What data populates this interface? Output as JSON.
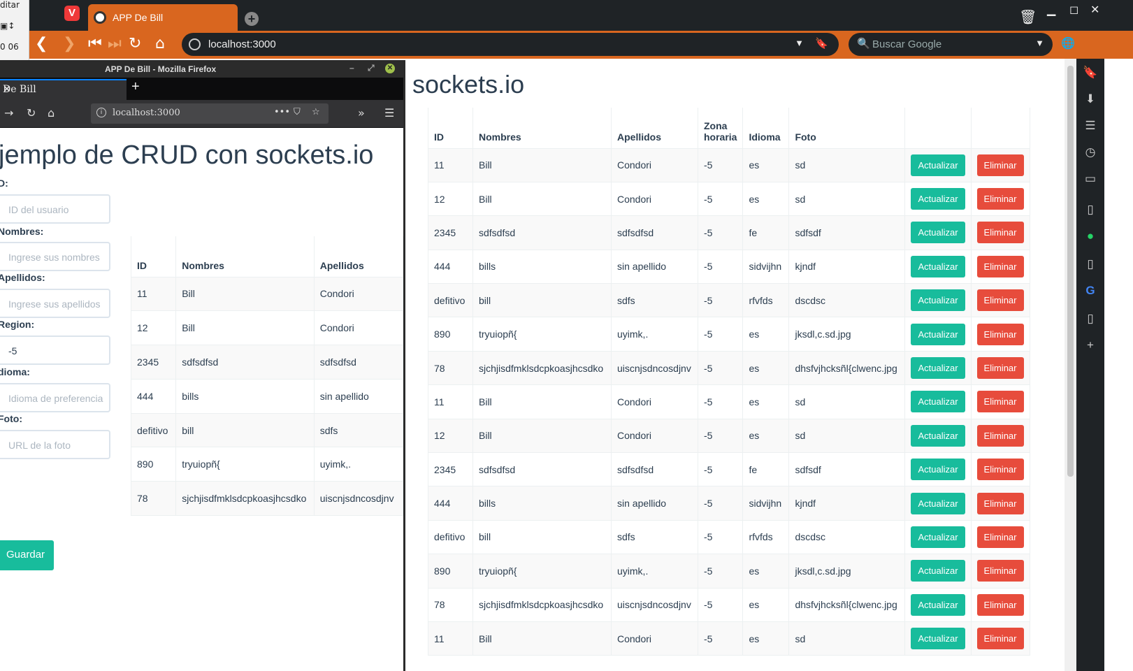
{
  "desktop": {
    "label_top": "ditar",
    "clock": "0 06"
  },
  "vivaldi": {
    "tab_title": "APP De Bill",
    "url": "localhost:3000",
    "search_placeholder": "Buscar Google"
  },
  "main_page": {
    "title_fragment": "n sockets.io",
    "columns": [
      "ID",
      "Nombres",
      "Apellidos",
      "Zona horaria",
      "Idioma",
      "Foto"
    ],
    "update_label": "Actualizar",
    "delete_label": "Eliminar",
    "rows": [
      [
        "11",
        "Bill",
        "Condori",
        "-5",
        "es",
        "sd"
      ],
      [
        "12",
        "Bill",
        "Condori",
        "-5",
        "es",
        "sd"
      ],
      [
        "2345",
        "sdfsdfsd",
        "sdfsdfsd",
        "-5",
        "fe",
        "sdfsdf"
      ],
      [
        "444",
        "bills",
        "sin apellido",
        "-5",
        "sidvijhn",
        "kjndf"
      ],
      [
        "defitivo",
        "bill",
        "sdfs",
        "-5",
        "rfvfds",
        "dscdsc"
      ],
      [
        "890",
        "tryuiopñ{",
        "uyimk,.",
        "-5",
        "es",
        "jksdl,c.sd.jpg"
      ],
      [
        "78",
        "sjchjisdfmklsdcpkoasjhcsdko",
        "uiscnjsdncosdjnv",
        "-5",
        "es",
        "dhsfvjhcksñl{clwenc.jpg"
      ],
      [
        "11",
        "Bill",
        "Condori",
        "-5",
        "es",
        "sd"
      ],
      [
        "12",
        "Bill",
        "Condori",
        "-5",
        "es",
        "sd"
      ],
      [
        "2345",
        "sdfsdfsd",
        "sdfsdfsd",
        "-5",
        "fe",
        "sdfsdf"
      ],
      [
        "444",
        "bills",
        "sin apellido",
        "-5",
        "sidvijhn",
        "kjndf"
      ],
      [
        "defitivo",
        "bill",
        "sdfs",
        "-5",
        "rfvfds",
        "dscdsc"
      ],
      [
        "890",
        "tryuiopñ{",
        "uyimk,.",
        "-5",
        "es",
        "jksdl,c.sd.jpg"
      ],
      [
        "78",
        "sjchjisdfmklsdcpkoasjhcsdko",
        "uiscnjsdncosdjnv",
        "-5",
        "es",
        "dhsfvjhcksñl{clwenc.jpg"
      ],
      [
        "11",
        "Bill",
        "Condori",
        "-5",
        "es",
        "sd"
      ]
    ]
  },
  "firefox": {
    "window_title": "APP De Bill - Mozilla Firefox",
    "tab_title": "De Bill",
    "url": "localhost:3000",
    "heading": "jemplo de CRUD con sockets.io",
    "form": {
      "id_label": "D:",
      "id_placeholder": "ID del usuario",
      "nombres_label": "Nombres:",
      "nombres_placeholder": "Ingrese sus nombres",
      "apellidos_label": "Apellidos:",
      "apellidos_placeholder": "Ingrese sus apellidos",
      "region_label": "Region:",
      "region_value": "-5",
      "idioma_label": "dioma:",
      "idioma_placeholder": "Idioma de preferencia",
      "foto_label": "Foto:",
      "foto_placeholder": "URL de la foto",
      "save_label": "Guardar"
    },
    "columns": [
      "ID",
      "Nombres",
      "Apellidos"
    ],
    "rows": [
      [
        "11",
        "Bill",
        "Condori"
      ],
      [
        "12",
        "Bill",
        "Condori"
      ],
      [
        "2345",
        "sdfsdfsd",
        "sdfsdfsd"
      ],
      [
        "444",
        "bills",
        "sin apellido"
      ],
      [
        "defitivo",
        "bill",
        "sdfs"
      ],
      [
        "890",
        "tryuiopñ{",
        "uyimk,."
      ],
      [
        "78",
        "sjchjisdfmklsdcpkoasjhcsdko",
        "uiscnjsdncosdjnv"
      ]
    ]
  }
}
